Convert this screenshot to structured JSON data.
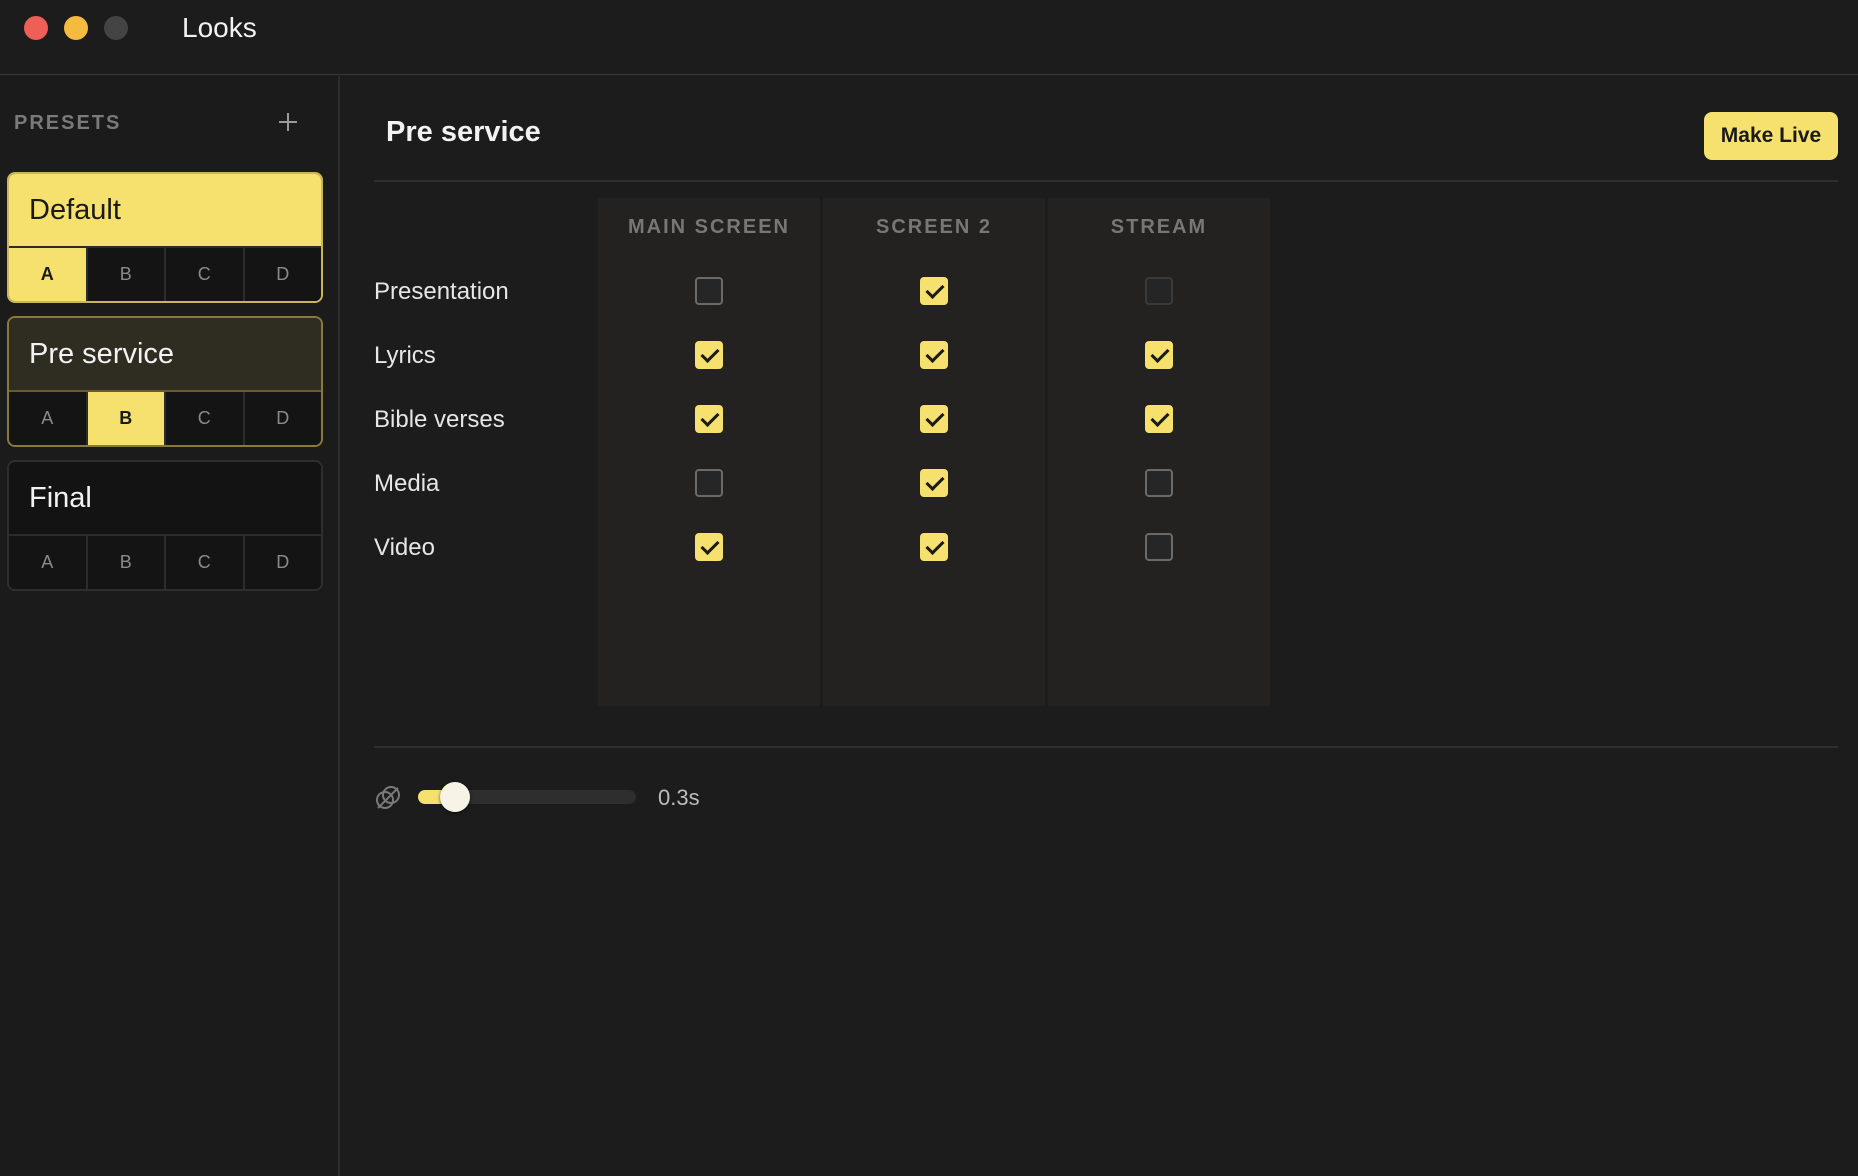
{
  "window": {
    "title": "Looks"
  },
  "sidebar": {
    "title": "PRESETS",
    "presets": [
      {
        "name": "Default",
        "slots": [
          "A",
          "B",
          "C",
          "D"
        ],
        "active_slot": 0
      },
      {
        "name": "Pre service",
        "slots": [
          "A",
          "B",
          "C",
          "D"
        ],
        "active_slot": 1
      },
      {
        "name": "Final",
        "slots": [
          "A",
          "B",
          "C",
          "D"
        ],
        "active_slot": null
      }
    ]
  },
  "main": {
    "title": "Pre service",
    "make_live_label": "Make Live",
    "columns": [
      "MAIN SCREEN",
      "SCREEN 2",
      "STREAM"
    ],
    "rows": [
      {
        "label": "Presentation",
        "values": [
          false,
          true,
          false
        ]
      },
      {
        "label": "Lyrics",
        "values": [
          true,
          true,
          true
        ]
      },
      {
        "label": "Bible verses",
        "values": [
          true,
          true,
          true
        ]
      },
      {
        "label": "Media",
        "values": [
          false,
          true,
          false
        ]
      },
      {
        "label": "Video",
        "values": [
          true,
          true,
          false
        ]
      }
    ],
    "transition": {
      "value_label": "0.3s",
      "fraction": 0.1
    }
  },
  "colors": {
    "accent": "#f6e06e",
    "background": "#1c1c1c"
  },
  "icons": {
    "add": "plus-icon",
    "transition": "transition-link-icon"
  }
}
